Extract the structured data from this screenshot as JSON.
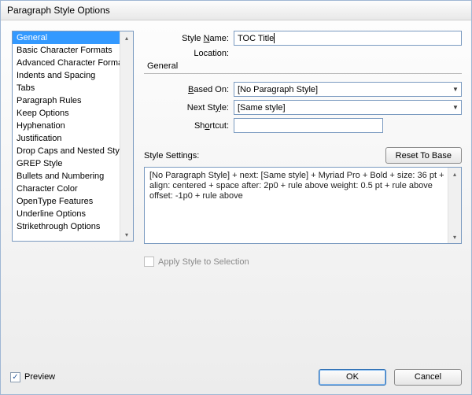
{
  "window": {
    "title": "Paragraph Style Options"
  },
  "sidebar": {
    "items": [
      "General",
      "Basic Character Formats",
      "Advanced Character Formats",
      "Indents and Spacing",
      "Tabs",
      "Paragraph Rules",
      "Keep Options",
      "Hyphenation",
      "Justification",
      "Drop Caps and Nested Styles",
      "GREP Style",
      "Bullets and Numbering",
      "Character Color",
      "OpenType Features",
      "Underline Options",
      "Strikethrough Options"
    ],
    "selectedIndex": 0
  },
  "form": {
    "styleName": {
      "label_pre": "Style ",
      "label_u": "N",
      "label_post": "ame:",
      "value": "TOC Title"
    },
    "location": {
      "label": "Location:",
      "value": ""
    },
    "sectionTitle": "General",
    "basedOn": {
      "label_u": "B",
      "label_post": "ased On:",
      "value": "[No Paragraph Style]"
    },
    "nextStyle": {
      "label_pre": "Next St",
      "label_u": "y",
      "label_post": "le:",
      "value": "[Same style]"
    },
    "shortcut": {
      "label_pre": "Sh",
      "label_u": "o",
      "label_post": "rtcut:",
      "value": ""
    },
    "settings": {
      "label": "Style Settings:",
      "resetLabel": "Reset To Base",
      "text": "[No Paragraph Style] + next: [Same style] + Myriad Pro + Bold + size: 36 pt + align: centered + space after: 2p0 + rule above weight: 0.5 pt + rule above offset: -1p0 + rule above"
    },
    "applyToSelection": {
      "label": "Apply Style to Selection",
      "checked": false
    }
  },
  "footer": {
    "preview": {
      "label_u": "P",
      "label_post": "review",
      "checked": true
    },
    "ok": "OK",
    "cancel": "Cancel"
  }
}
